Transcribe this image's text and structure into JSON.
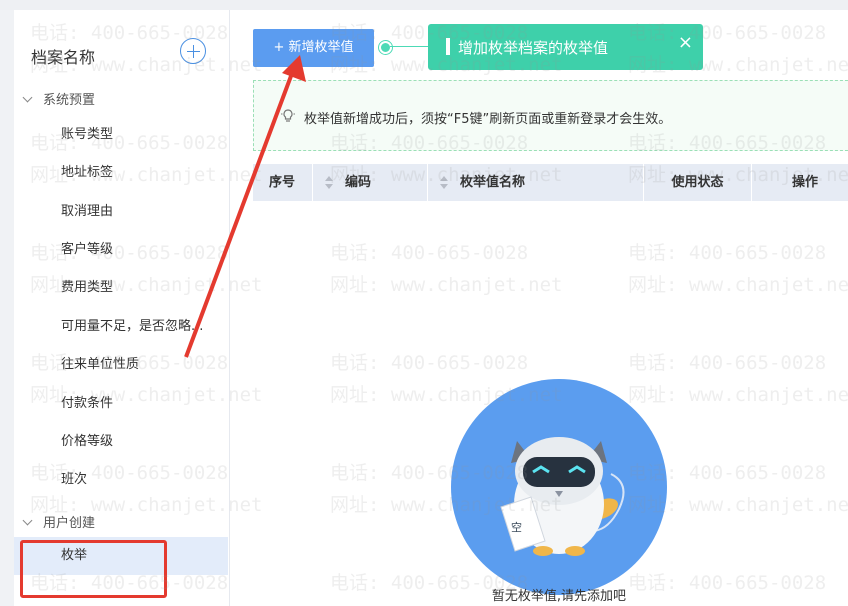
{
  "sidebar": {
    "title": "档案名称",
    "groups": [
      {
        "label": "系统预置"
      },
      {
        "label": "用户创建"
      }
    ],
    "items": [
      {
        "label": "账号类型"
      },
      {
        "label": "地址标签"
      },
      {
        "label": "取消理由"
      },
      {
        "label": "客户等级"
      },
      {
        "label": "费用类型"
      },
      {
        "label": "可用量不足，是否忽略..."
      },
      {
        "label": "往来单位性质"
      },
      {
        "label": "付款条件"
      },
      {
        "label": "价格等级"
      },
      {
        "label": "班次"
      },
      {
        "label": "枚举"
      }
    ]
  },
  "toolbar": {
    "add_label": "+ 新增枚举值"
  },
  "tooltip": {
    "text": "增加枚举档案的枚举值",
    "close": "×"
  },
  "notice": {
    "text": "枚举值新增成功后，须按“F5键”刷新页面或重新登录才会生效。"
  },
  "table": {
    "columns": [
      "序号",
      "编码",
      "枚举值名称",
      "使用状态",
      "操作"
    ]
  },
  "empty": {
    "text": "暂无枚举值,请先添加吧"
  },
  "watermark": {
    "phone": "电话: 400-665-0028",
    "site": "网址: www.chanjet.net"
  },
  "colors": {
    "accent": "#5b9cf0",
    "tooltip": "#3ed0aa",
    "highlight": "#e43a2f"
  }
}
